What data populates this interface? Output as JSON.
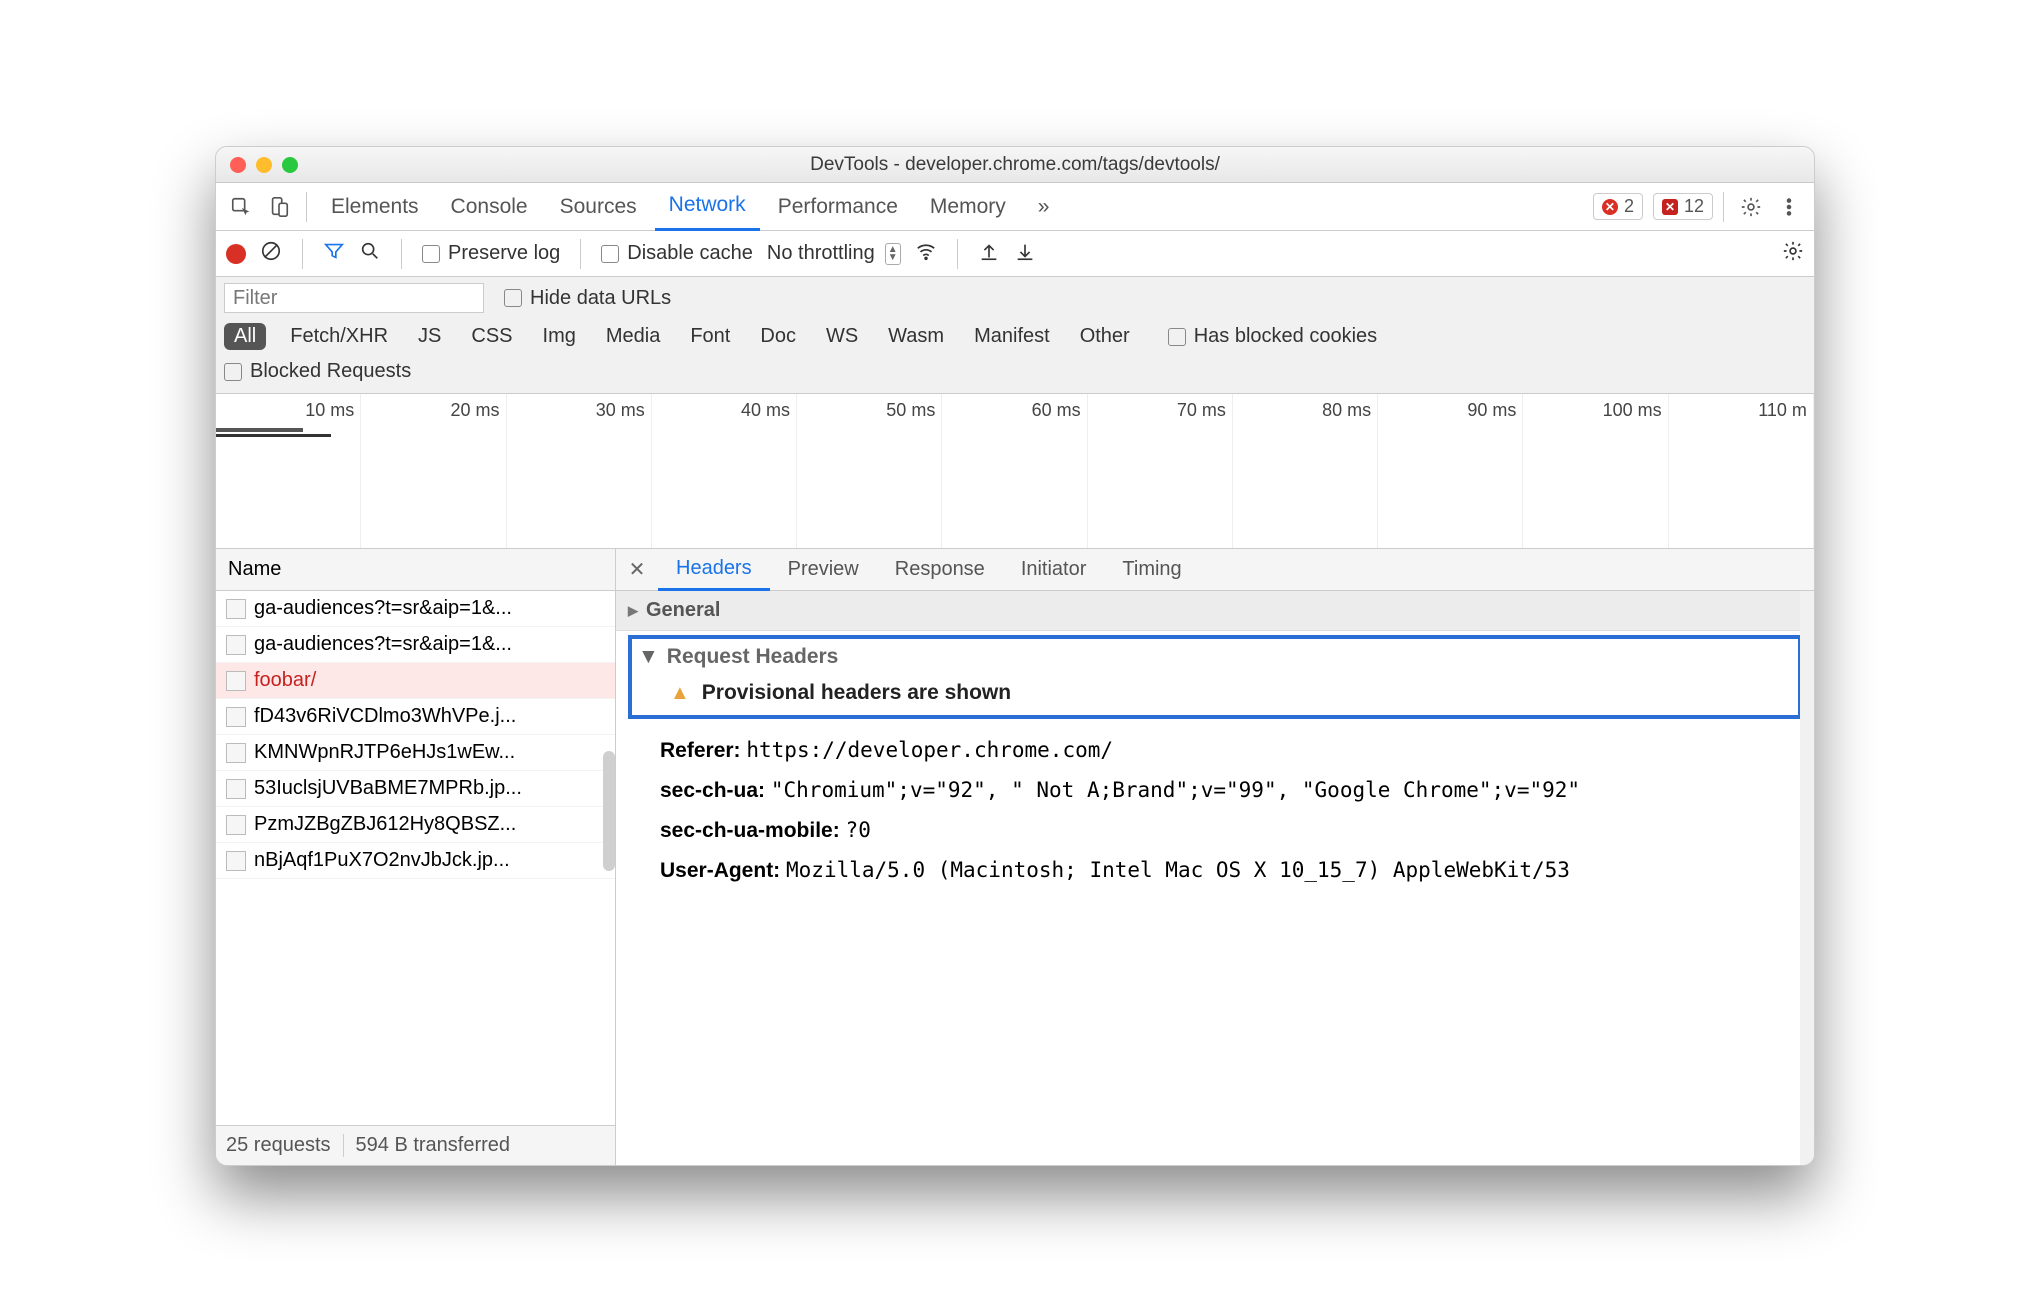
{
  "window": {
    "title": "DevTools - developer.chrome.com/tags/devtools/"
  },
  "tabs": {
    "items": [
      "Elements",
      "Console",
      "Sources",
      "Network",
      "Performance",
      "Memory"
    ],
    "active": "Network",
    "overflow": "»",
    "error_count": "2",
    "issue_count": "12"
  },
  "net_toolbar": {
    "preserve_log": "Preserve log",
    "disable_cache": "Disable cache",
    "throttling": "No throttling"
  },
  "filter": {
    "placeholder": "Filter",
    "hide_data_urls": "Hide data URLs",
    "types": [
      "All",
      "Fetch/XHR",
      "JS",
      "CSS",
      "Img",
      "Media",
      "Font",
      "Doc",
      "WS",
      "Wasm",
      "Manifest",
      "Other"
    ],
    "active_type": "All",
    "has_blocked_cookies": "Has blocked cookies",
    "blocked_requests": "Blocked Requests"
  },
  "timeline": {
    "labels": [
      "10 ms",
      "20 ms",
      "30 ms",
      "40 ms",
      "50 ms",
      "60 ms",
      "70 ms",
      "80 ms",
      "90 ms",
      "100 ms",
      "110 m"
    ]
  },
  "requests": {
    "header": "Name",
    "items": [
      {
        "name": "ga-audiences?t=sr&aip=1&..."
      },
      {
        "name": "ga-audiences?t=sr&aip=1&..."
      },
      {
        "name": "foobar/",
        "error": true
      },
      {
        "name": "fD43v6RiVCDlmo3WhVPe.j..."
      },
      {
        "name": "KMNWpnRJTP6eHJs1wEw..."
      },
      {
        "name": "53IuclsjUVBaBME7MPRb.jp..."
      },
      {
        "name": "PzmJZBgZBJ612Hy8QBSZ..."
      },
      {
        "name": "nBjAqf1PuX7O2nvJbJck.jp..."
      }
    ],
    "status": {
      "count": "25 requests",
      "transferred": "594 B transferred"
    }
  },
  "detail": {
    "tabs": [
      "Headers",
      "Preview",
      "Response",
      "Initiator",
      "Timing"
    ],
    "active": "Headers",
    "general": "General",
    "request_headers": "Request Headers",
    "provisional": "Provisional headers are shown",
    "headers": [
      {
        "k": "Referer:",
        "v": "https://developer.chrome.com/"
      },
      {
        "k": "sec-ch-ua:",
        "v": "\"Chromium\";v=\"92\", \" Not A;Brand\";v=\"99\", \"Google Chrome\";v=\"92\""
      },
      {
        "k": "sec-ch-ua-mobile:",
        "v": "?0"
      },
      {
        "k": "User-Agent:",
        "v": "Mozilla/5.0 (Macintosh; Intel Mac OS X 10_15_7) AppleWebKit/53"
      }
    ]
  }
}
